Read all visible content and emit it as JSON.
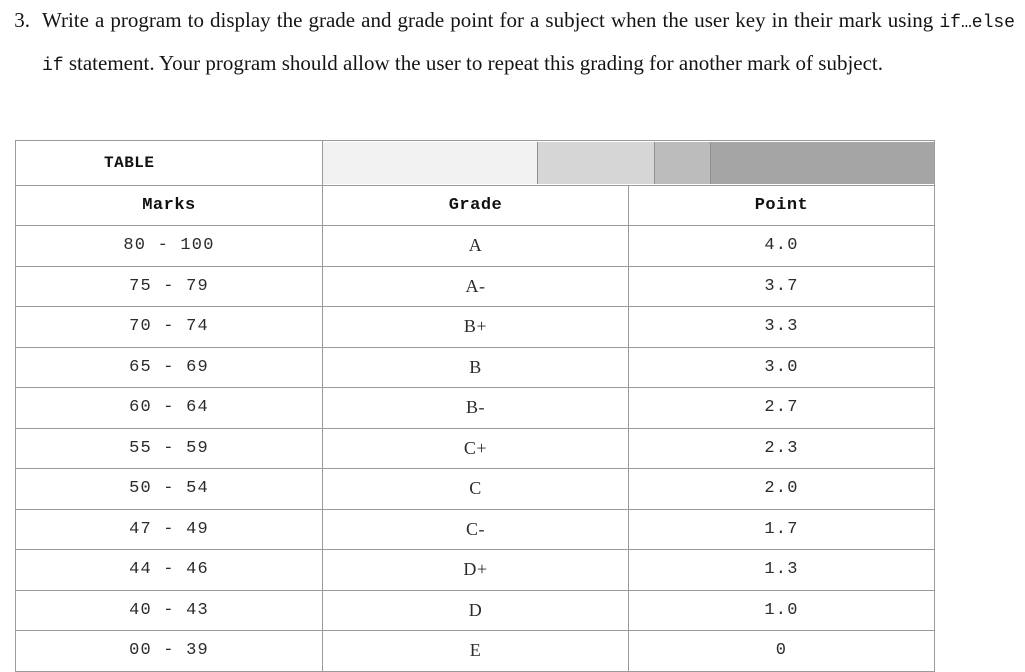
{
  "question": {
    "number": "3.",
    "text_part1": "Write a program to display the grade and grade point for a subject when the user key in their mark using ",
    "code_snippet": "if…else if",
    "text_part2": " statement. Your program should allow the user to repeat this grading for another mark of subject."
  },
  "table": {
    "title": "TABLE",
    "header_segments": [
      "",
      "",
      "",
      ""
    ],
    "columns": [
      "Marks",
      "Grade",
      "Point"
    ],
    "rows": [
      {
        "marks": "80 - 100",
        "grade": "A",
        "point": "4.0"
      },
      {
        "marks": "75 - 79",
        "grade": "A-",
        "point": "3.7"
      },
      {
        "marks": "70 - 74",
        "grade": "B+",
        "point": "3.3"
      },
      {
        "marks": "65 - 69",
        "grade": "B",
        "point": "3.0"
      },
      {
        "marks": "60 - 64",
        "grade": "B-",
        "point": "2.7"
      },
      {
        "marks": "55 - 59",
        "grade": "C+",
        "point": "2.3"
      },
      {
        "marks": "50 - 54",
        "grade": "C",
        "point": "2.0"
      },
      {
        "marks": "47 - 49",
        "grade": "C-",
        "point": "1.7"
      },
      {
        "marks": "44 - 46",
        "grade": "D+",
        "point": "1.3"
      },
      {
        "marks": "40 - 43",
        "grade": "D",
        "point": "1.0"
      },
      {
        "marks": "00 - 39",
        "grade": "E",
        "point": "0"
      }
    ]
  },
  "colors": {
    "border": "#9a9a9a",
    "text": "#2b2b2b",
    "segment_1": "#f2f2f2",
    "segment_2": "#d6d6d6",
    "segment_3": "#bcbcbc",
    "segment_4": "#a5a5a5"
  }
}
